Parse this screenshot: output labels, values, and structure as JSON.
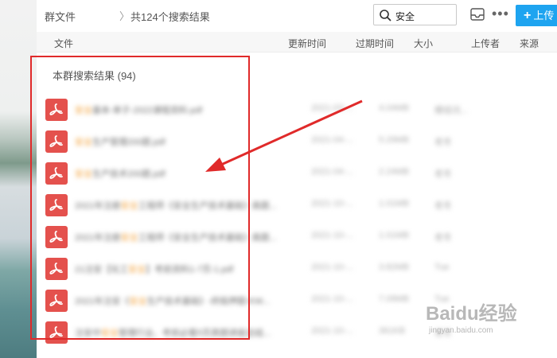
{
  "header": {
    "breadcrumb_root": "群文件",
    "breadcrumb_sep": "〉",
    "breadcrumb_current": "共124个搜索结果",
    "search_value": "安全",
    "more_label": "•••",
    "upload_label": "上传"
  },
  "columns": {
    "file": "文件",
    "updated": "更新时间",
    "expires": "过期时间",
    "size": "大小",
    "uploader": "上传者",
    "source": "来源"
  },
  "section": {
    "title": "本群搜索结果 (94)"
  },
  "files": [
    {
      "pre": "",
      "hl": "安全",
      "post": "基本-单子-2022课程资料.pdf",
      "date": "2021-03-...",
      "size": "4.04MB",
      "uploader": "模组讯..."
    },
    {
      "pre": "",
      "hl": "安全",
      "post": "生产管理200题.pdf",
      "date": "2021-04-...",
      "size": "5.29MB",
      "uploader": "老冬"
    },
    {
      "pre": "",
      "hl": "安全",
      "post": "生产技术200题.pdf",
      "date": "2021-04-...",
      "size": "2.24MB",
      "uploader": "老冬"
    },
    {
      "pre": "2021年注册",
      "hl": "安全",
      "post": "工程师《安全生产技术基础》高题...",
      "date": "2021-10-...",
      "size": "1.01MB",
      "uploader": "老冬"
    },
    {
      "pre": "2021年注册",
      "hl": "安全",
      "post": "工程师《安全生产技术基础》高题...",
      "date": "2021-10-...",
      "size": "1.01MB",
      "uploader": "老冬"
    },
    {
      "pre": "21注安【化工",
      "hl": "安全",
      "post": "】考前资料1-7页-1.pdf",
      "date": "2021-10-...",
      "size": "3.82MB",
      "uploader": "Tue"
    },
    {
      "pre": "2021年注安《",
      "hl": "安全",
      "post": "生产技术基础》-终极押题-KW...",
      "date": "2021-10-...",
      "size": "7.09MB",
      "uploader": "Tue"
    },
    {
      "pre": "注安中",
      "hl": "安全",
      "post": "管理行业、考前必看5页真题讲座总结...",
      "date": "2021-10-...",
      "size": "361KB",
      "uploader": "老冬"
    }
  ],
  "watermark": {
    "logo": "Baidu经验",
    "url": "jingyan.baidu.com"
  },
  "colors": {
    "accent": "#1ea4f0",
    "pdf": "#e4514d",
    "highlight": "#f3a23a",
    "annotation": "#e02a2a"
  }
}
